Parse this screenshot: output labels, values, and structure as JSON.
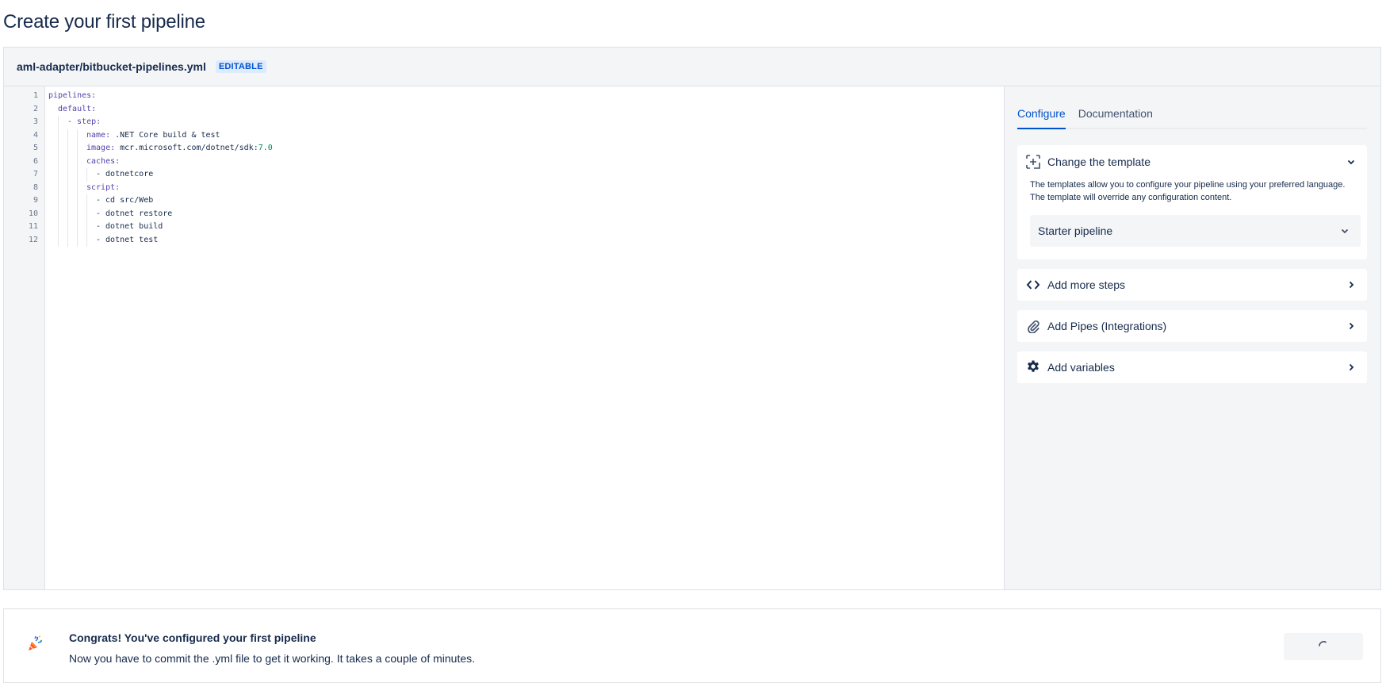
{
  "page": {
    "title": "Create your first pipeline"
  },
  "editor": {
    "file_name": "aml-adapter/bitbucket-pipelines.yml",
    "badge": "EDITABLE",
    "line_numbers": [
      "1",
      "2",
      "3",
      "4",
      "5",
      "6",
      "7",
      "8",
      "9",
      "10",
      "11",
      "12"
    ],
    "lines": [
      {
        "key": "pipelines:",
        "value": ""
      },
      {
        "key": "default:",
        "value": ""
      },
      {
        "key": "- step:",
        "value": ""
      },
      {
        "key": "name:",
        "value": " .NET Core build & test"
      },
      {
        "key": "image:",
        "value": " mcr.microsoft.com/dotnet/sdk:",
        "num": "7.0"
      },
      {
        "key": "caches:",
        "value": ""
      },
      {
        "key": "",
        "value": "- dotnetcore"
      },
      {
        "key": "script:",
        "value": ""
      },
      {
        "key": "",
        "value": "- cd src/Web"
      },
      {
        "key": "",
        "value": "- dotnet restore"
      },
      {
        "key": "",
        "value": "- dotnet build"
      },
      {
        "key": "",
        "value": "- dotnet test"
      }
    ]
  },
  "side_panel": {
    "tabs": [
      {
        "label": "Configure",
        "active": true
      },
      {
        "label": "Documentation",
        "active": false
      }
    ],
    "change_template": {
      "label": "Change the template",
      "icon": "template-add-icon",
      "description_1": "The templates allow you to configure your pipeline using your preferred language.",
      "description_2": "The template will override any configuration content.",
      "selected": "Starter pipeline"
    },
    "items": [
      {
        "label": "Add more steps",
        "icon": "code-brackets-icon"
      },
      {
        "label": "Add Pipes (Integrations)",
        "icon": "paperclip-icon"
      },
      {
        "label": "Add variables",
        "icon": "gear-icon"
      }
    ]
  },
  "congrats": {
    "title": "Congrats! You've configured your first pipeline",
    "text": "Now you have to commit the .yml file to get it working. It takes a couple of minutes.",
    "icon": "party-popper-icon"
  },
  "colors": {
    "accent": "#0052cc",
    "text": "#172b4d",
    "panel_bg": "#f4f5f7",
    "yaml_key": "#5243aa",
    "yaml_number": "#00875a"
  }
}
